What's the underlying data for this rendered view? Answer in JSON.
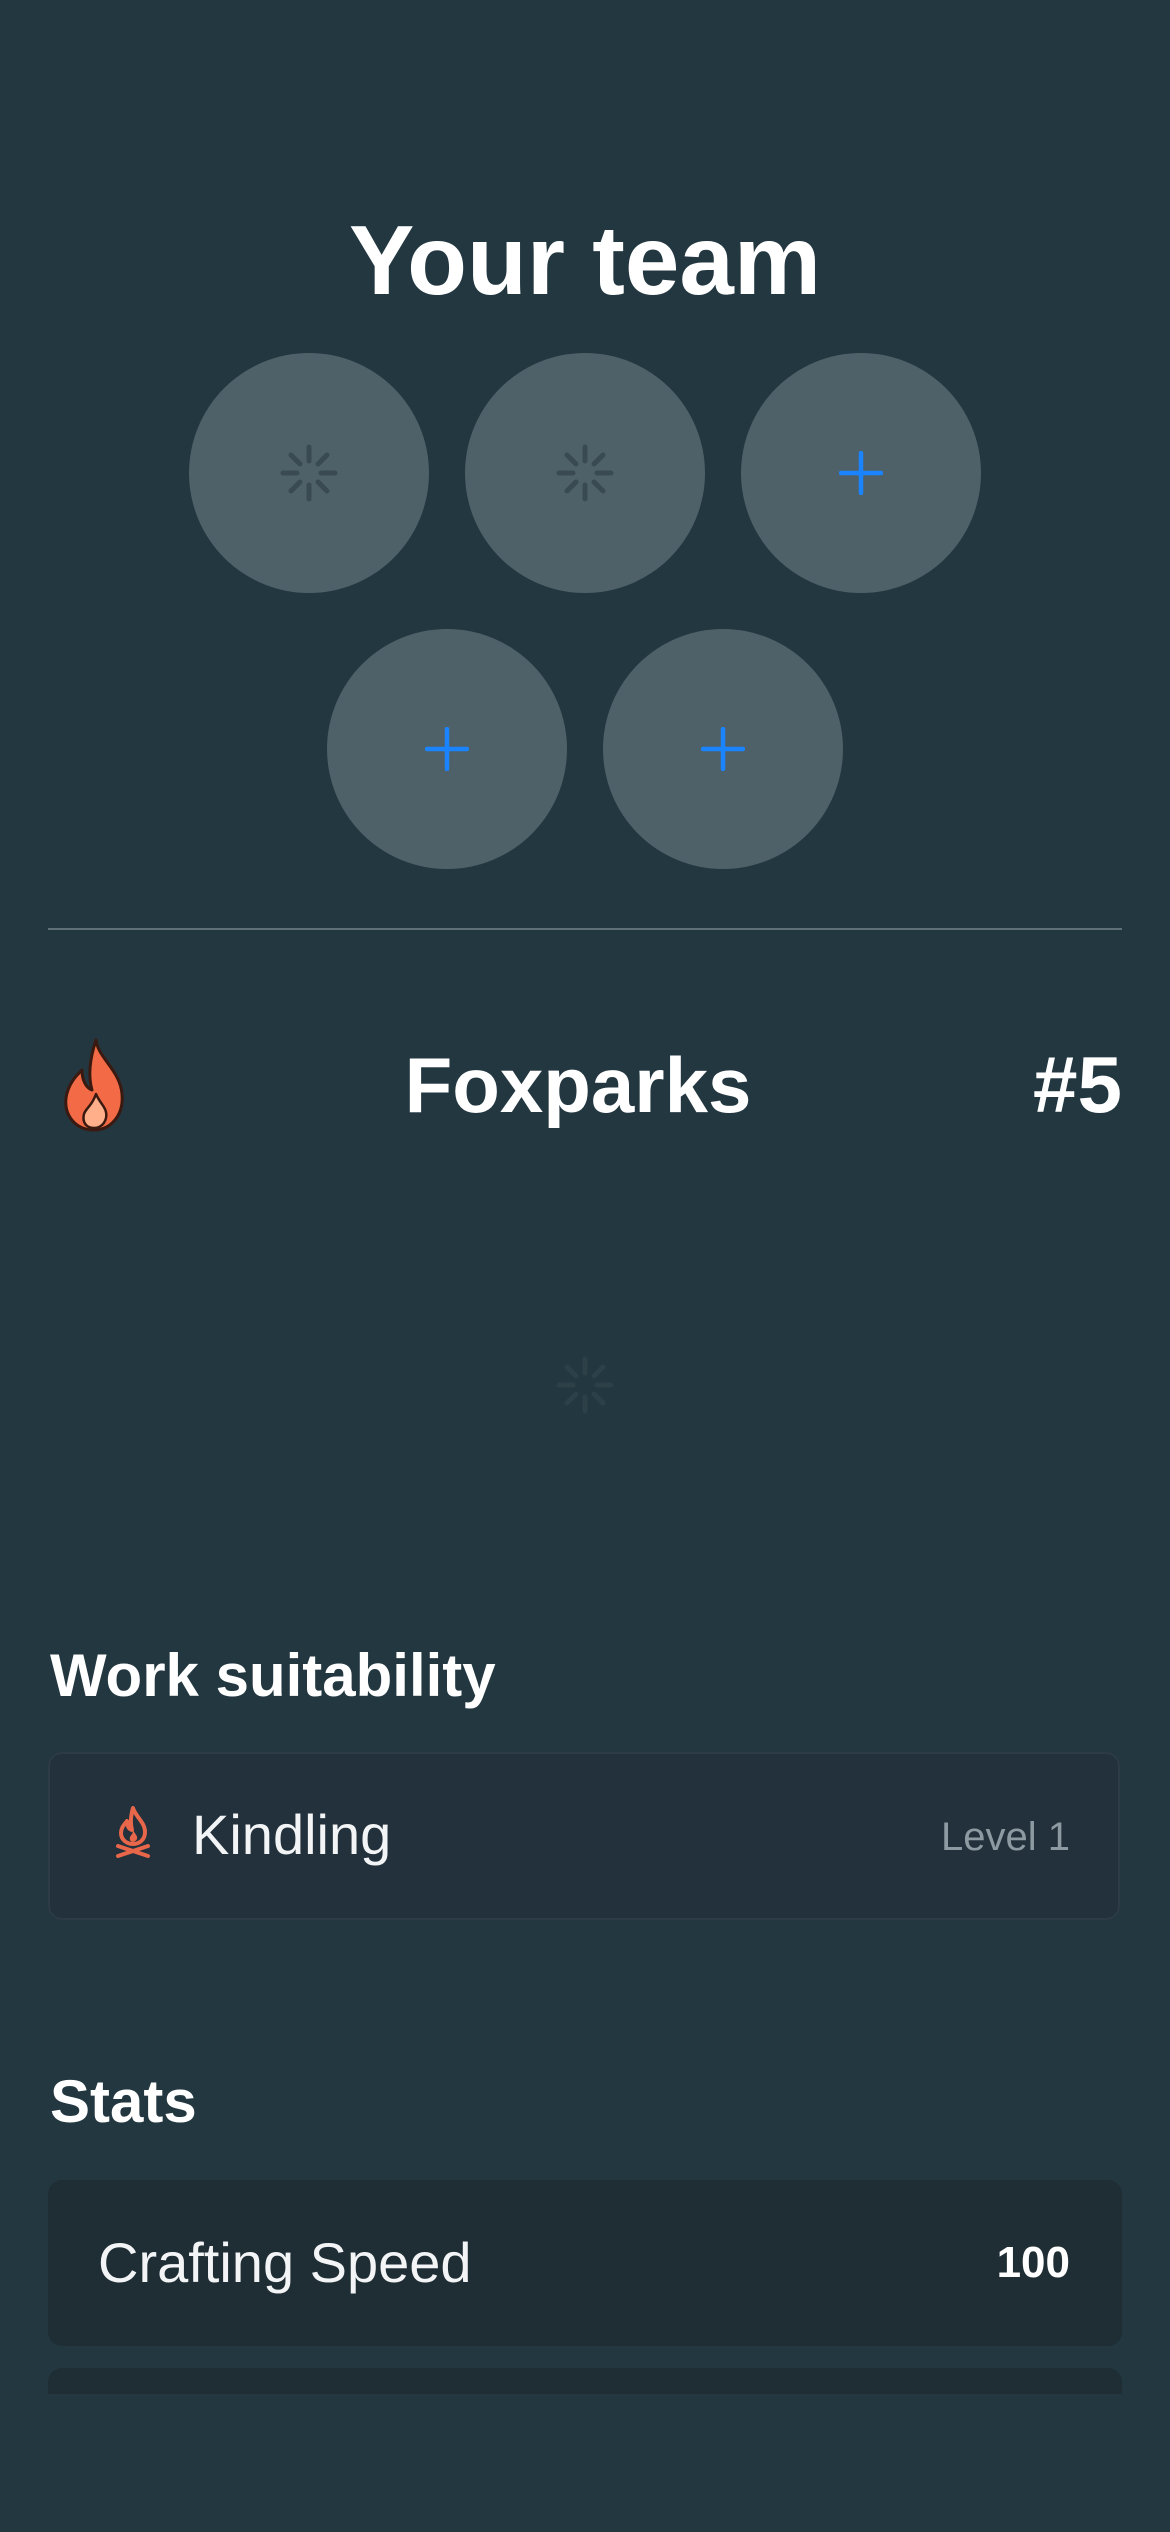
{
  "team": {
    "title": "Your team",
    "slots": [
      {
        "state": "loading",
        "icon": "spinner-icon"
      },
      {
        "state": "loading",
        "icon": "spinner-icon"
      },
      {
        "state": "empty",
        "icon": "plus-icon"
      },
      {
        "state": "empty",
        "icon": "plus-icon"
      },
      {
        "state": "empty",
        "icon": "plus-icon"
      }
    ]
  },
  "pal": {
    "element_icon": "fire-icon",
    "name": "Foxparks",
    "number": "#5",
    "image_state": "loading"
  },
  "work_suitability": {
    "title": "Work suitability",
    "items": [
      {
        "icon": "kindling-icon",
        "label": "Kindling",
        "level": "Level 1"
      }
    ]
  },
  "stats": {
    "title": "Stats",
    "items": [
      {
        "label": "Crafting Speed",
        "value": "100"
      }
    ]
  },
  "colors": {
    "background": "#233740",
    "slot": "#4e6068",
    "accent_blue": "#1a84ff",
    "fire": "#f26b46",
    "card": "#22313b"
  }
}
